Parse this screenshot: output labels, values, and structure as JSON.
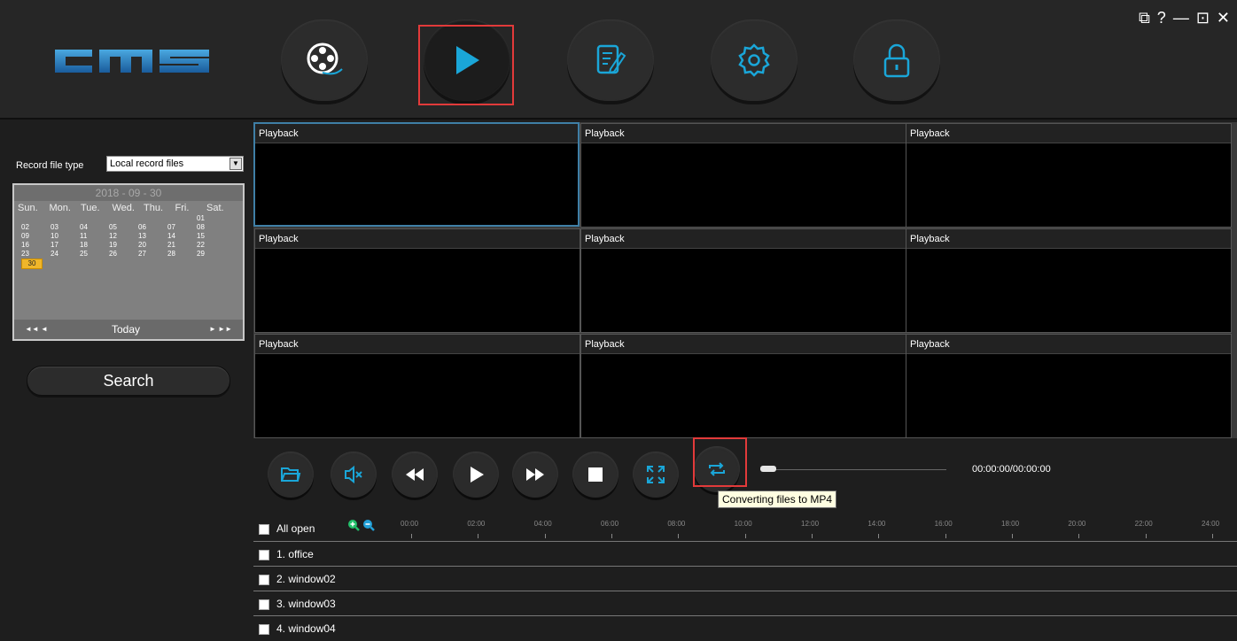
{
  "window_controls": [
    "⧉",
    "?",
    "—",
    "⊡",
    "✕"
  ],
  "colors": {
    "accent": "#1aa6d8",
    "highlight": "#e23a3a",
    "selected_day": "#f0b62a"
  },
  "nav": {
    "items": [
      {
        "name": "recording-icon"
      },
      {
        "name": "playback-icon",
        "selected": true
      },
      {
        "name": "log-edit-icon"
      },
      {
        "name": "settings-gear-icon"
      },
      {
        "name": "lock-icon"
      }
    ]
  },
  "left": {
    "record_type_label": "Record file type",
    "record_type_value": "Local record files",
    "calendar": {
      "header": "2018 - 09 - 30",
      "dow": [
        "Sun.",
        "Mon.",
        "Tue.",
        "Wed.",
        "Thu.",
        "Fri.",
        "Sat."
      ],
      "today_label": "Today",
      "nav_left": "◄◄  ◄",
      "nav_right": "►  ►►",
      "selected": "30"
    },
    "search_label": "Search"
  },
  "panes": [
    {
      "title": "Playback"
    },
    {
      "title": "Playback"
    },
    {
      "title": "Playback"
    },
    {
      "title": "Playback"
    },
    {
      "title": "Playback"
    },
    {
      "title": "Playback"
    },
    {
      "title": "Playback"
    },
    {
      "title": "Playback"
    },
    {
      "title": "Playback"
    }
  ],
  "controls": {
    "buttons": [
      "open-folder-icon",
      "mute-icon",
      "rewind-icon",
      "play-icon",
      "fast-forward-icon",
      "stop-icon",
      "fullscreen-icon",
      "convert-mp4-icon"
    ],
    "progress": 0,
    "timecode": "00:00:00/00:00:00",
    "tooltip": "Converting files to MP4"
  },
  "timeline": {
    "all_open": "All open",
    "hours": [
      "00:00",
      "02:00",
      "04:00",
      "06:00",
      "08:00",
      "10:00",
      "12:00",
      "14:00",
      "16:00",
      "18:00",
      "20:00",
      "22:00",
      "24:00"
    ],
    "channels": [
      "1. office",
      "2. window02",
      "3. window03",
      "4. window04"
    ]
  }
}
